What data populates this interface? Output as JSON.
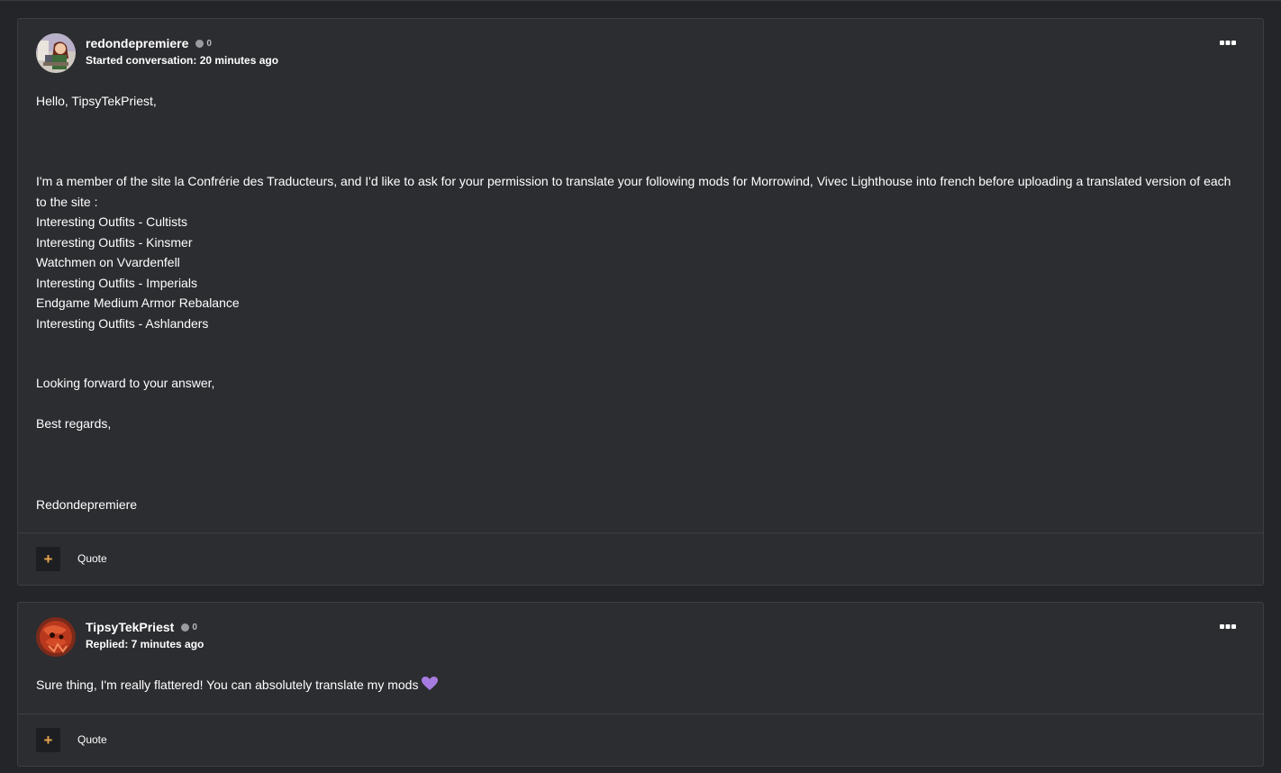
{
  "posts": [
    {
      "username": "redondepremiere",
      "reputation": "0",
      "meta": "Started conversation: 20 minutes ago",
      "paragraphs": {
        "greeting": "Hello, TipsyTekPriest,",
        "intro": "I'm a member of the site la Confrérie des Traducteurs, and I'd like to ask for your permission to translate your following mods for Morrowind, Vivec Lighthouse into french before uploading a translated version of each to the site :",
        "mods": [
          "Interesting Outfits - Cultists",
          "Interesting Outfits - Kinsmer",
          "Watchmen on Vvardenfell",
          "Interesting Outfits - Imperials",
          "Endgame Medium Armor Rebalance",
          "Interesting Outfits - Ashlanders"
        ],
        "closing": "Looking forward to your answer,",
        "regards": "Best regards,",
        "signature": "Redondepremiere"
      },
      "quote_label": "Quote",
      "avatar_icon": "user-avatar-woman-at-desk"
    },
    {
      "username": "TipsyTekPriest",
      "reputation": "0",
      "meta": "Replied: 7 minutes ago",
      "text": "Sure thing, I'm really flattered! You can absolutely translate my mods",
      "emoji_icon": "purple-heart-icon",
      "quote_label": "Quote",
      "avatar_icon": "user-avatar-red-creature"
    }
  ],
  "colors": {
    "page_bg": "#242528",
    "post_bg": "#2c2d30",
    "border": "#3d3e42",
    "accent": "#e8a64e",
    "heart": "#a77ce0"
  }
}
